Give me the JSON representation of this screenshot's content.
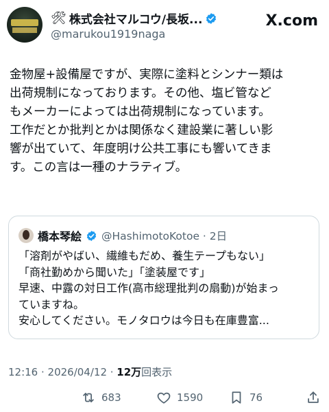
{
  "post": {
    "author": {
      "display_name": "株式会社マルコウ/長坂...",
      "handle": "@marukou1919naga",
      "verified": true
    },
    "source_logo": "X.com",
    "text": "金物屋+設備屋ですが、実際に塗料とシンナー類は\n出荷規制になっております。その他、塩ビ管など\nもメーカーによっては出荷規制になっています。\n工作だとか批判とかは関係なく建設業に著しい影\n響が出ていて、年度明け公共工事にも響いてきま\nす。この言は一種のナラティブ。",
    "quote": {
      "display_name": "橋本琴絵",
      "handle_and_time": "@HashimotoKotoe · 2日",
      "text": "「溶剤がやばい、繊維もだめ、養生テープもない」\n「商社勤めから聞いた」「塗装屋です」\n早速、中露の対日工作(高市総理批判の扇動)が始まっ\nていますね。\n安心してください。モノタロウは今日も在庫豊富..."
    },
    "meta": {
      "time_date": "12:16 · 2026/04/12 · ",
      "views_count": "12万",
      "views_label": "回表示"
    },
    "actions": {
      "retweets": "683",
      "likes": "1590",
      "bookmarks": "76"
    }
  },
  "icons": [
    "tools-icon",
    "verified-badge-icon",
    "retweet-icon",
    "heart-icon",
    "bookmark-icon",
    "share-icon"
  ],
  "colors": {
    "verified": "#1d9bf0",
    "secondary_text": "#536471",
    "border": "#cfd9de"
  }
}
